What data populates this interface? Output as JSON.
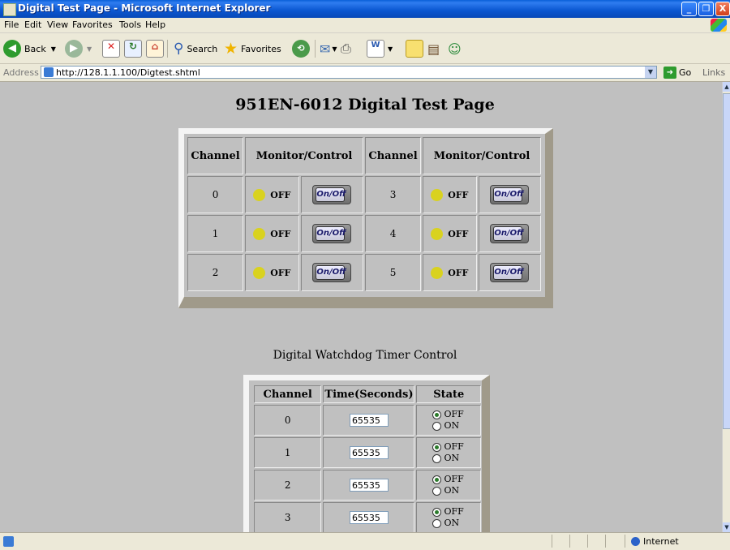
{
  "window": {
    "title": "Digital Test Page - Microsoft Internet Explorer",
    "controls": [
      "_",
      "❐",
      "X"
    ]
  },
  "menu": [
    "File",
    "Edit",
    "View",
    "Favorites",
    "Tools",
    "Help"
  ],
  "toolbar": {
    "back": "Back",
    "search": "Search",
    "favorites": "Favorites"
  },
  "address": {
    "label": "Address",
    "url": "http://128.1.1.100/Digtest.shtml",
    "go": "Go",
    "links": "Links"
  },
  "page": {
    "title": "951EN-6012 Digital Test Page",
    "digital": {
      "headers": [
        "Channel",
        "Monitor/Control",
        "Channel",
        "Monitor/Control"
      ],
      "rows": [
        {
          "left": {
            "channel": "0",
            "state": "OFF",
            "button": "On/Off"
          },
          "right": {
            "channel": "3",
            "state": "OFF",
            "button": "On/Off"
          }
        },
        {
          "left": {
            "channel": "1",
            "state": "OFF",
            "button": "On/Off"
          },
          "right": {
            "channel": "4",
            "state": "OFF",
            "button": "On/Off"
          }
        },
        {
          "left": {
            "channel": "2",
            "state": "OFF",
            "button": "On/Off"
          },
          "right": {
            "channel": "5",
            "state": "OFF",
            "button": "On/Off"
          }
        }
      ]
    },
    "watchdog": {
      "title": "Digital Watchdog Timer Control",
      "headers": [
        "Channel",
        "Time(Seconds)",
        "State"
      ],
      "rows": [
        {
          "channel": "0",
          "time": "65535",
          "off": "OFF",
          "on": "ON",
          "selected": "OFF"
        },
        {
          "channel": "1",
          "time": "65535",
          "off": "OFF",
          "on": "ON",
          "selected": "OFF"
        },
        {
          "channel": "2",
          "time": "65535",
          "off": "OFF",
          "on": "ON",
          "selected": "OFF"
        },
        {
          "channel": "3",
          "time": "65535",
          "off": "OFF",
          "on": "ON",
          "selected": "OFF"
        }
      ]
    }
  },
  "status": {
    "zone": "Internet"
  }
}
